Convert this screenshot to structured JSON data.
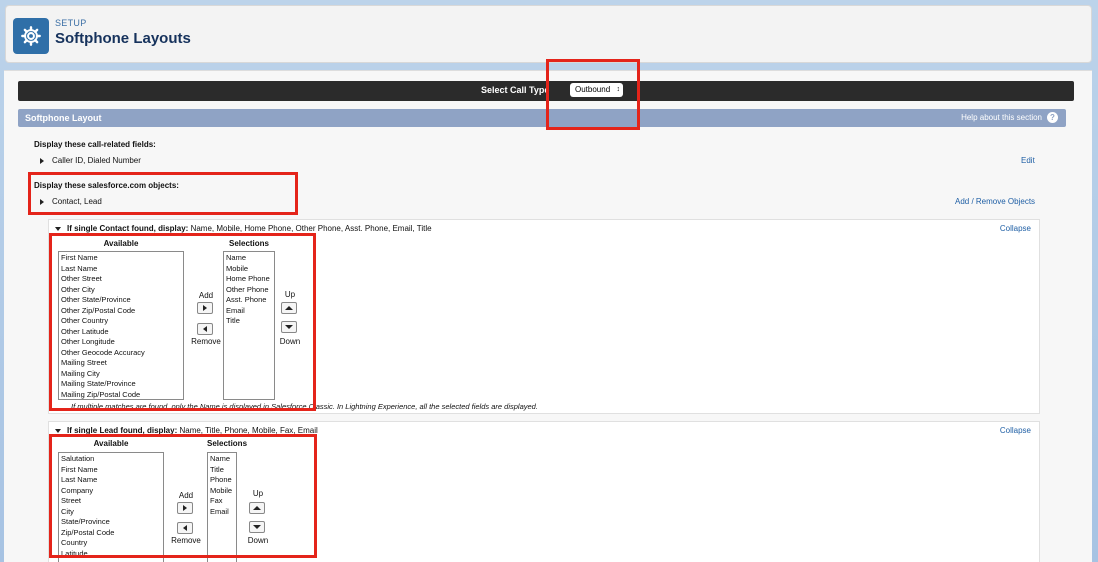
{
  "header": {
    "breadcrumb": "SETUP",
    "title": "Softphone Layouts",
    "icon": "gear-icon"
  },
  "call_bar": {
    "label": "Select Call Type",
    "selected": "Outbound"
  },
  "section": {
    "title": "Softphone Layout",
    "help_link": "Help about this section",
    "help_icon": "?"
  },
  "call_fields": {
    "heading": "Display these call-related fields:",
    "value": "Caller ID, Dialed Number",
    "edit_link": "Edit"
  },
  "objects": {
    "heading": "Display these salesforce.com objects:",
    "value": "Contact, Lead",
    "add_remove_link": "Add / Remove Objects"
  },
  "contact_box": {
    "heading": "If single Contact found, display:",
    "fields_summary": "Name, Mobile, Home Phone, Other Phone, Asst. Phone, Email, Title",
    "collapse": "Collapse",
    "available_label": "Available",
    "selections_label": "Selections",
    "available": [
      "First Name",
      "Last Name",
      "Other Street",
      "Other City",
      "Other State/Province",
      "Other Zip/Postal Code",
      "Other Country",
      "Other Latitude",
      "Other Longitude",
      "Other Geocode Accuracy",
      "Mailing Street",
      "Mailing City",
      "Mailing State/Province",
      "Mailing Zip/Postal Code"
    ],
    "selections": [
      "Name",
      "Mobile",
      "Home Phone",
      "Other Phone",
      "Asst. Phone",
      "Email",
      "Title"
    ],
    "add": "Add",
    "remove": "Remove",
    "up": "Up",
    "down": "Down",
    "note": "If multiple matches are found, only the Name is displayed in Salesforce Classic. In Lightning Experience, all the selected fields are displayed."
  },
  "lead_box": {
    "heading": "If single Lead found, display:",
    "fields_summary": "Name, Title, Phone, Mobile, Fax, Email",
    "collapse": "Collapse",
    "available_label": "Available",
    "selections_label": "Selections",
    "available": [
      "Salutation",
      "First Name",
      "Last Name",
      "Company",
      "Street",
      "City",
      "State/Province",
      "Zip/Postal Code",
      "Country",
      "Latitude"
    ],
    "selections": [
      "Name",
      "Title",
      "Phone",
      "Mobile",
      "Fax",
      "Email"
    ],
    "add": "Add",
    "remove": "Remove",
    "up": "Up",
    "down": "Down"
  },
  "colors": {
    "highlight": "#e4241a",
    "section_bar": "#8fa3c5",
    "call_bar": "#2b2b2b",
    "link": "#1f5fa5"
  }
}
